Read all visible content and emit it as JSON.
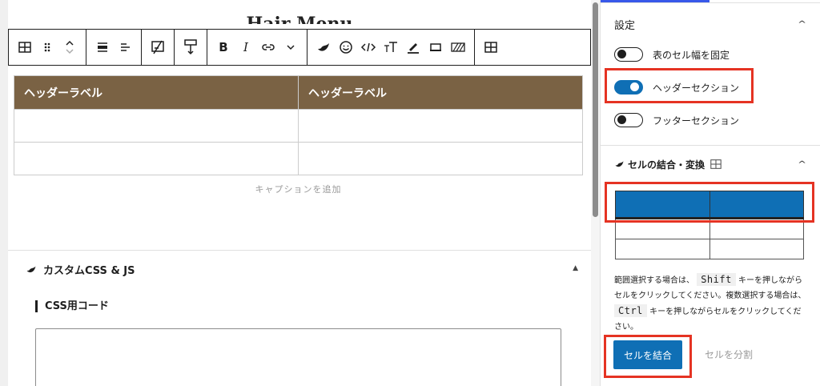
{
  "editor": {
    "doc_title": "Hair Menu",
    "table": {
      "headers": [
        "ヘッダーラベル",
        "ヘッダーラベル"
      ],
      "rows": [
        [
          "",
          ""
        ],
        [
          "",
          ""
        ]
      ]
    },
    "caption_placeholder": "キャプションを追加",
    "custom_css_panel": {
      "title": "カスタムCSS & JS",
      "toggle": "▲",
      "field_label": "CSS用コード",
      "code_value": ""
    }
  },
  "toolbar": {
    "icons": [
      "table-icon",
      "drag-handle-icon",
      "move-up-down-icon",
      "align-icon",
      "text-align-icon",
      "caption-toggle-icon",
      "table-height-icon",
      "bold-icon",
      "italic-icon",
      "link-icon",
      "more-options-icon",
      "plugin-leaf-icon",
      "emoji-icon",
      "code-icon",
      "font-size-icon",
      "highlight-icon",
      "inline-box-icon",
      "striped-pattern-icon",
      "table-grid-icon"
    ],
    "bold_label": "B",
    "italic_label": "I"
  },
  "sidebar": {
    "settings": {
      "title": "設定",
      "toggles": [
        {
          "label": "表のセル幅を固定",
          "on": false
        },
        {
          "label": "ヘッダーセクション",
          "on": true
        },
        {
          "label": "フッターセクション",
          "on": false
        }
      ]
    },
    "merge_panel": {
      "title": "セルの結合・変換",
      "help_parts": [
        "範囲選択する場合は、",
        "Shift",
        "キーを押しながらセルをクリックしてください。複数選択する場合は、",
        "Ctrl",
        "キーを押しながらセルをクリックしてください。"
      ],
      "merge_button": "セルを結合",
      "split_button": "セルを分割"
    },
    "chevron": "^"
  },
  "colors": {
    "header_bg": "#7a6244",
    "accent_blue": "#0f6fb5",
    "highlight_red": "#e53323",
    "tab_blue": "#3858e9"
  }
}
